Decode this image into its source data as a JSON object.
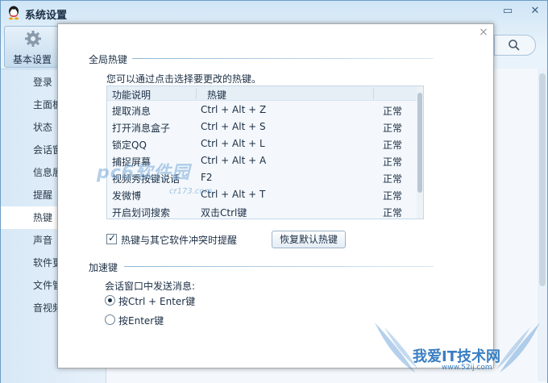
{
  "window": {
    "title": "系统设置",
    "minimize_glyph": "▭",
    "close_glyph": "✕"
  },
  "topnav": {
    "basic_settings": "基本设置"
  },
  "sidebar": {
    "items": [
      {
        "label": "登录"
      },
      {
        "label": "主面板"
      },
      {
        "label": "状态"
      },
      {
        "label": "会话窗"
      },
      {
        "label": "信息展"
      },
      {
        "label": "提醒"
      },
      {
        "label": "热键"
      },
      {
        "label": "声音"
      },
      {
        "label": "软件更"
      },
      {
        "label": "文件管"
      },
      {
        "label": "音视频"
      }
    ],
    "active_label": "热键"
  },
  "dialog": {
    "close_glyph": "×",
    "global_hotkeys": {
      "title": "全局热键",
      "description": "您可以通过点击选择要更改的热键。",
      "columns": [
        "功能说明",
        "热键"
      ],
      "rows": [
        {
          "function": "提取消息",
          "hotkey": "Ctrl + Alt + Z",
          "status": "正常"
        },
        {
          "function": "打开消息盒子",
          "hotkey": "Ctrl + Alt + S",
          "status": "正常"
        },
        {
          "function": "锁定QQ",
          "hotkey": "Ctrl + Alt + L",
          "status": "正常"
        },
        {
          "function": "捕捉屏幕",
          "hotkey": "Ctrl + Alt + A",
          "status": "正常"
        },
        {
          "function": "视频秀按键说话",
          "hotkey": "F2",
          "status": "正常"
        },
        {
          "function": "发微博",
          "hotkey": "Ctrl + Alt + T",
          "status": "正常"
        },
        {
          "function": "开启划词搜索",
          "hotkey": "双击Ctrl键",
          "status": "正常"
        }
      ],
      "conflict_checkbox": {
        "label": "热键与其它软件冲突时提醒",
        "checked": true
      },
      "restore_button": "恢复默认热键"
    },
    "accelerator": {
      "title": "加速键",
      "description": "会话窗口中发送消息:",
      "options": [
        {
          "label": "按Ctrl + Enter键",
          "selected": true
        },
        {
          "label": "按Enter键",
          "selected": false
        }
      ]
    }
  },
  "watermarks": {
    "site1": "pc6软件园",
    "site1_url": "cr173.com",
    "site2": "我爱IT技术网",
    "site2_url": "www.52ij.com"
  }
}
